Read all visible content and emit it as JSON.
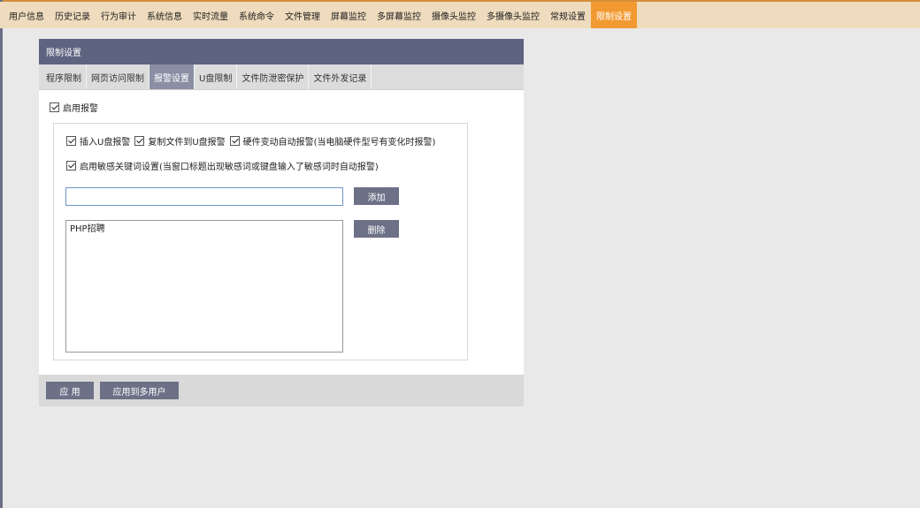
{
  "menubar": {
    "items": [
      {
        "label": "用户信息"
      },
      {
        "label": "历史记录"
      },
      {
        "label": "行为审计"
      },
      {
        "label": "系统信息"
      },
      {
        "label": "实时流量"
      },
      {
        "label": "系统命令"
      },
      {
        "label": "文件管理"
      },
      {
        "label": "屏幕监控"
      },
      {
        "label": "多屏幕监控"
      },
      {
        "label": "摄像头监控"
      },
      {
        "label": "多摄像头监控"
      },
      {
        "label": "常规设置"
      },
      {
        "label": "限制设置"
      }
    ],
    "active_index": 12
  },
  "panel": {
    "title": "限制设置",
    "tabs": [
      {
        "label": "程序限制"
      },
      {
        "label": "网页访问限制"
      },
      {
        "label": "报警设置"
      },
      {
        "label": "U盘限制"
      },
      {
        "label": "文件防泄密保护"
      },
      {
        "label": "文件外发记录"
      }
    ],
    "active_tab": 2,
    "enable_alarm": {
      "label": "启用报警",
      "checked": true
    },
    "options": {
      "usb_insert": {
        "label": "插入U盘报警",
        "checked": true
      },
      "copy_to_usb": {
        "label": "复制文件到U盘报警",
        "checked": true
      },
      "hardware_change": {
        "label": "硬件变动自动报警(当电脑硬件型号有变化时报警)",
        "checked": true
      },
      "sensitive_keywords": {
        "label": "启用敏感关键词设置(当窗口标题出现敏感词或键盘输入了敏感词时自动报警)",
        "checked": true
      }
    },
    "keyword_input": {
      "value": "",
      "placeholder": ""
    },
    "add_button": "添加",
    "delete_button": "删除",
    "keywords": [
      "PHP招聘"
    ],
    "apply_button": "应 用",
    "apply_multi_button": "应用到多用户"
  },
  "colors": {
    "menubar_bg": "#efdbbd",
    "menu_active": "#f29a32",
    "header_bg": "#5e6480",
    "tab_active": "#8b8fa5",
    "button_bg": "#6c7187"
  }
}
